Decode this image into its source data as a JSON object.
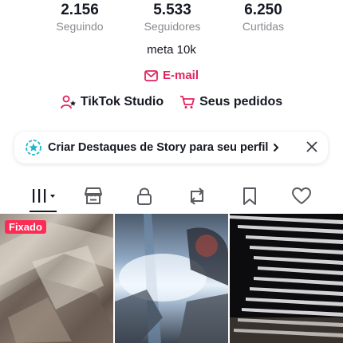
{
  "stats": [
    {
      "value": "2.156",
      "label": "Seguindo"
    },
    {
      "value": "5.533",
      "label": "Seguidores"
    },
    {
      "value": "6.250",
      "label": "Curtidas"
    }
  ],
  "bio": "meta 10k",
  "email": {
    "label": "E-mail",
    "icon": "mail-icon"
  },
  "tools": [
    {
      "label": "TikTok Studio",
      "icon": "person-star-icon"
    },
    {
      "label": "Seus pedidos",
      "icon": "shopping-cart-icon"
    }
  ],
  "banner": {
    "text": "Criar Destaques de Story para seu perfil",
    "icon": "highlight-star-icon",
    "chevron": "chevron-right-icon",
    "close": "close-icon"
  },
  "tabs": [
    {
      "name": "videos",
      "icon": "grid-bars-icon",
      "active": true
    },
    {
      "name": "shop",
      "icon": "storefront-icon"
    },
    {
      "name": "private",
      "icon": "lock-icon"
    },
    {
      "name": "reposts",
      "icon": "repost-icon"
    },
    {
      "name": "favorites",
      "icon": "bookmark-icon"
    },
    {
      "name": "liked",
      "icon": "heart-icon"
    }
  ],
  "videos": [
    {
      "badge": "Fixado"
    },
    {
      "badge": ""
    },
    {
      "badge": ""
    }
  ],
  "colors": {
    "accent": "#fe2c55",
    "email": "#e0245e",
    "text": "#161823",
    "muted": "#8a8b91"
  }
}
